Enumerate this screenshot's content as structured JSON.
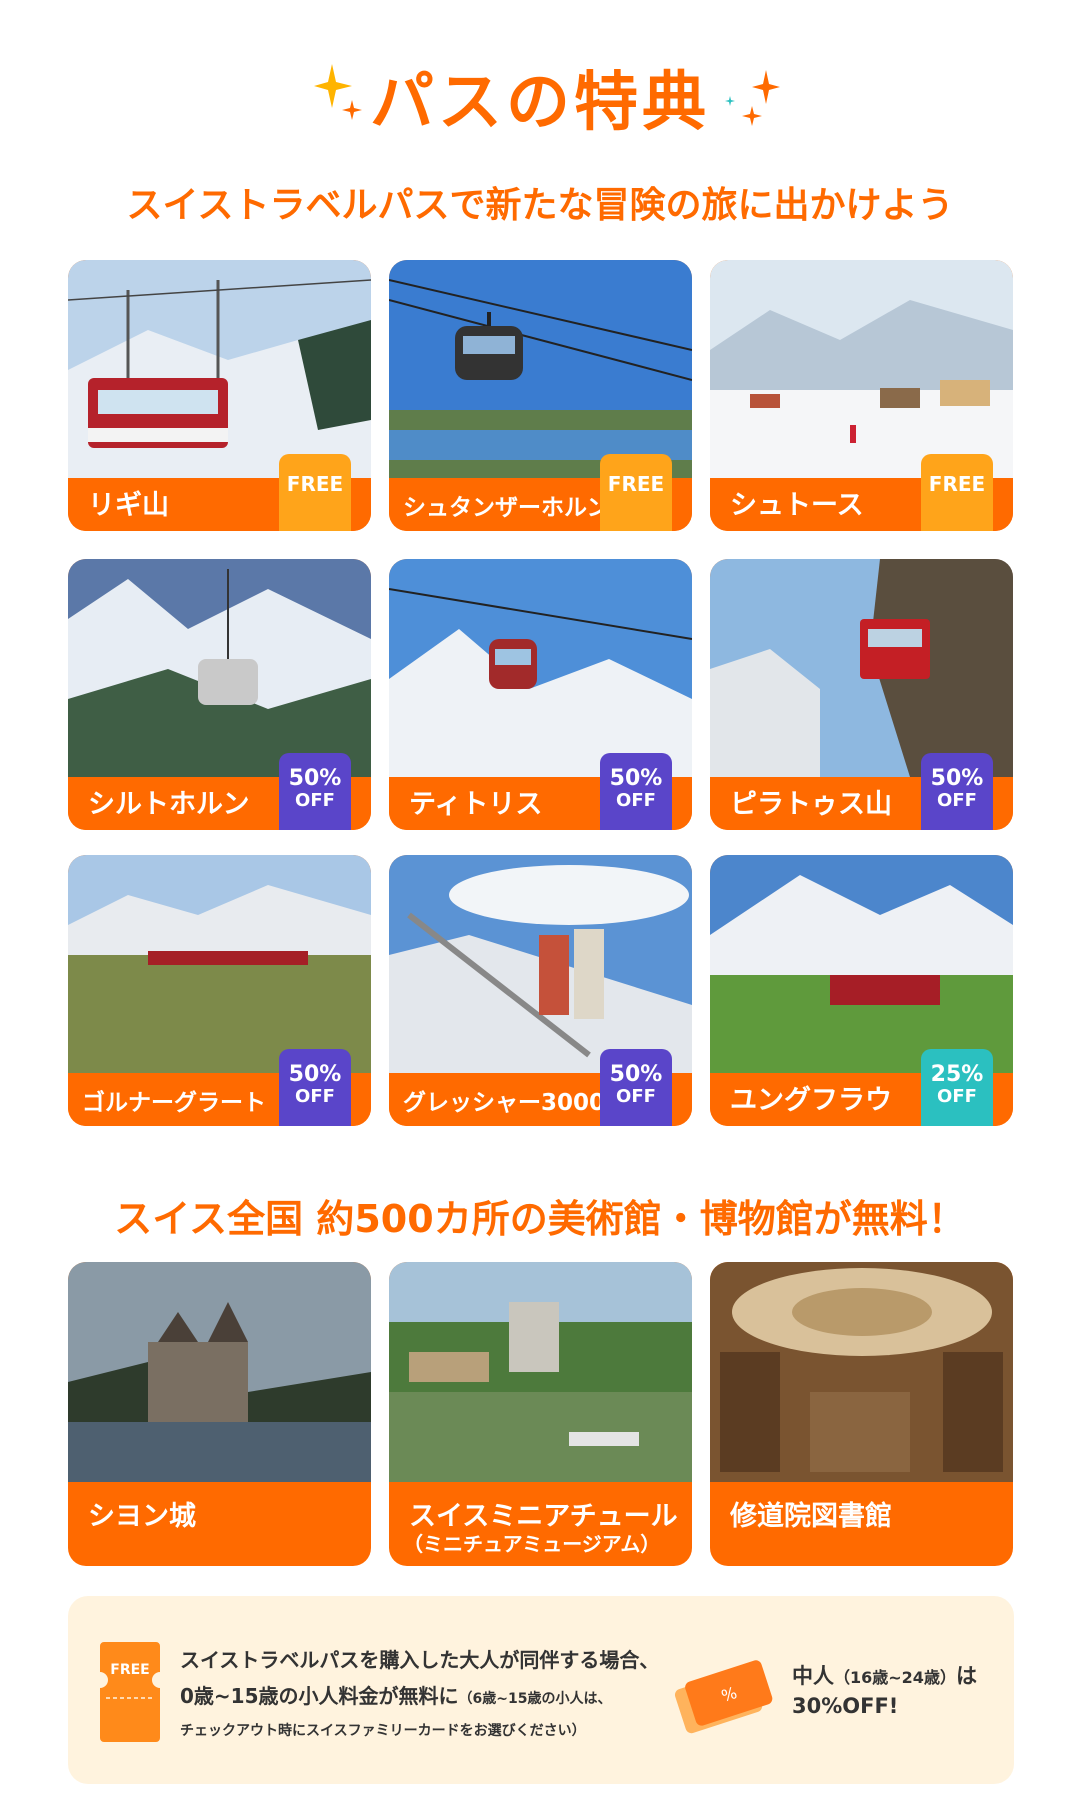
{
  "header": {
    "title": "パスの特典",
    "subtitle": "スイストラベルパスで新たな冒険の旅に出かけよう"
  },
  "attractions": [
    {
      "name": "リギ山",
      "badge_top": "FREE",
      "badge_bottom": "",
      "badge_type": "free"
    },
    {
      "name": "シュタンザーホルン",
      "badge_top": "FREE",
      "badge_bottom": "",
      "badge_type": "free"
    },
    {
      "name": "シュトース",
      "badge_top": "FREE",
      "badge_bottom": "",
      "badge_type": "free"
    },
    {
      "name": "シルトホルン",
      "badge_top": "50%",
      "badge_bottom": "OFF",
      "badge_type": "half"
    },
    {
      "name": "ティトリス",
      "badge_top": "50%",
      "badge_bottom": "OFF",
      "badge_type": "half"
    },
    {
      "name": "ピラトゥス山",
      "badge_top": "50%",
      "badge_bottom": "OFF",
      "badge_type": "half"
    },
    {
      "name": "ゴルナーグラート",
      "badge_top": "50%",
      "badge_bottom": "OFF",
      "badge_type": "half"
    },
    {
      "name": "グレッシャー3000",
      "badge_top": "50%",
      "badge_bottom": "OFF",
      "badge_type": "half"
    },
    {
      "name": "ユングフラウ",
      "badge_top": "25%",
      "badge_bottom": "OFF",
      "badge_type": "quarter"
    }
  ],
  "museums": {
    "heading": "スイス全国 約500カ所の美術館・博物館が無料！",
    "items": [
      {
        "name": "シヨン城",
        "sub": ""
      },
      {
        "name": "スイスミニアチュール",
        "sub": "（ミニチュアミュージアム）"
      },
      {
        "name": "修道院図書館",
        "sub": ""
      }
    ]
  },
  "info": {
    "ticket_label": "FREE",
    "line1": "スイストラベルパスを購入した大人が同伴する場合、",
    "line2_main": "0歳~15歳の小人料金が無料に",
    "line2_small": "（6歳~15歳の小人は、",
    "line3": "チェックアウト時にスイスファミリーカードをお選びください）",
    "youth_main": "中人",
    "youth_small": "（16歳~24歳）",
    "youth_suffix": "は",
    "youth_discount": "30%OFF!"
  },
  "colors": {
    "accent": "#ff6a00",
    "free_badge": "#ffa41a",
    "half_badge": "#5a45c9",
    "quarter_badge": "#2bc0c0",
    "info_bg": "#fff3de"
  }
}
